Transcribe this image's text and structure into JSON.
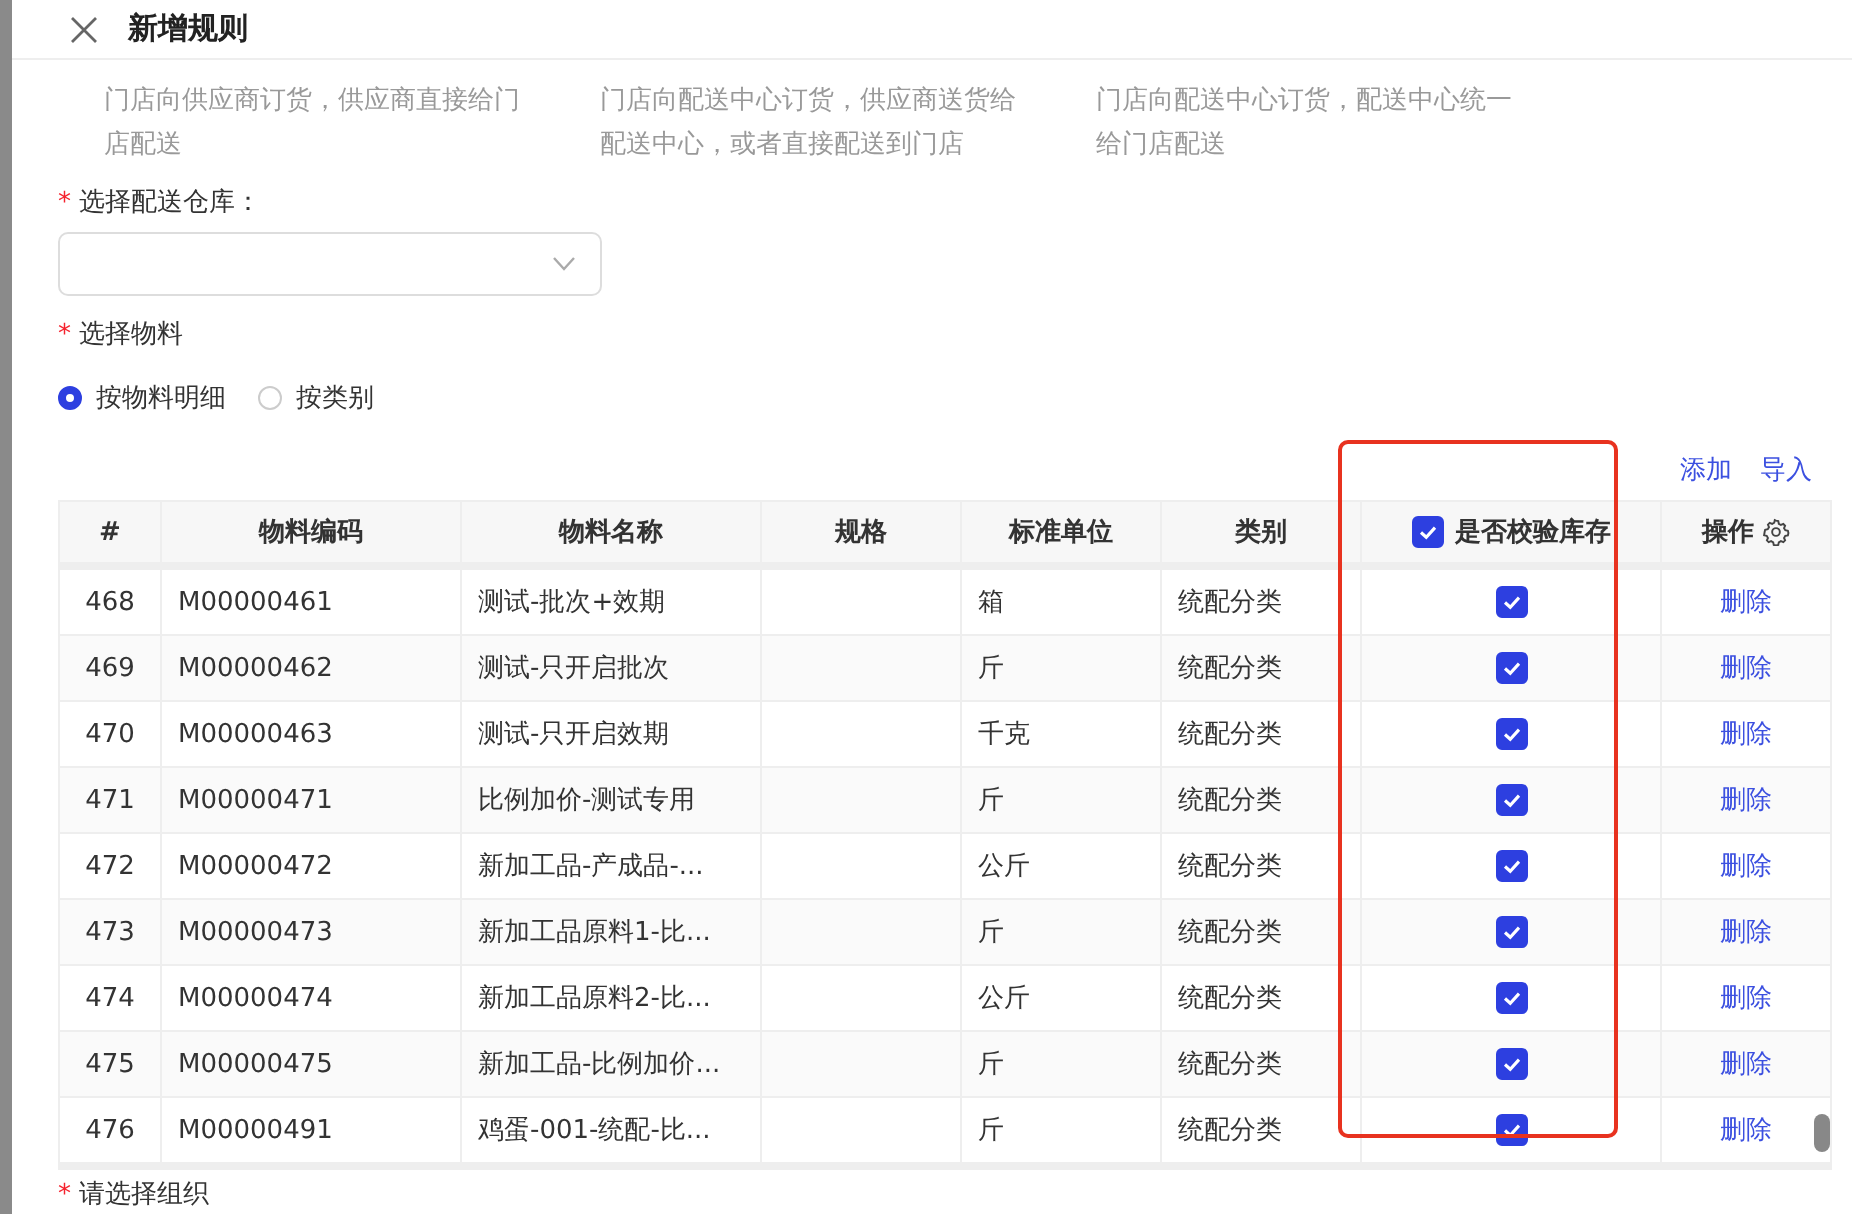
{
  "drawer": {
    "title": "新增规则"
  },
  "mode_descriptions": [
    "门店向供应商订货，供应商直接给门店配送",
    "门店向配送中心订货，供应商送货给配送中心，或者直接配送到门店",
    "门店向配送中心订货，配送中心统一给门店配送"
  ],
  "warehouse_field": {
    "required_mark": "*",
    "label": "选择配送仓库："
  },
  "material_section": {
    "required_mark": "*",
    "label": "选择物料",
    "radio_options": [
      {
        "label": "按物料明细",
        "selected": true
      },
      {
        "label": "按类别",
        "selected": false
      }
    ]
  },
  "table_actions": [
    "添加",
    "导入"
  ],
  "table": {
    "columns": [
      "#",
      "物料编码",
      "物料名称",
      "规格",
      "标准单位",
      "类别",
      "是否校验库存",
      "操作"
    ],
    "header_check_all": true,
    "rows": [
      {
        "index": "468",
        "code": "M00000461",
        "name": "测试-批次+效期",
        "spec": "",
        "unit": "箱",
        "category": "统配分类",
        "check_stock": true,
        "action": "删除"
      },
      {
        "index": "469",
        "code": "M00000462",
        "name": "测试-只开启批次",
        "spec": "",
        "unit": "斤",
        "category": "统配分类",
        "check_stock": true,
        "action": "删除"
      },
      {
        "index": "470",
        "code": "M00000463",
        "name": "测试-只开启效期",
        "spec": "",
        "unit": "千克",
        "category": "统配分类",
        "check_stock": true,
        "action": "删除"
      },
      {
        "index": "471",
        "code": "M00000471",
        "name": "比例加价-测试专用",
        "spec": "",
        "unit": "斤",
        "category": "统配分类",
        "check_stock": true,
        "action": "删除"
      },
      {
        "index": "472",
        "code": "M00000472",
        "name": "新加工品-产成品-...",
        "spec": "",
        "unit": "公斤",
        "category": "统配分类",
        "check_stock": true,
        "action": "删除"
      },
      {
        "index": "473",
        "code": "M00000473",
        "name": "新加工品原料1-比...",
        "spec": "",
        "unit": "斤",
        "category": "统配分类",
        "check_stock": true,
        "action": "删除"
      },
      {
        "index": "474",
        "code": "M00000474",
        "name": "新加工品原料2-比...",
        "spec": "",
        "unit": "公斤",
        "category": "统配分类",
        "check_stock": true,
        "action": "删除"
      },
      {
        "index": "475",
        "code": "M00000475",
        "name": "新加工品-比例加价...",
        "spec": "",
        "unit": "斤",
        "category": "统配分类",
        "check_stock": true,
        "action": "删除"
      },
      {
        "index": "476",
        "code": "M00000491",
        "name": "鸡蛋-001-统配-比...",
        "spec": "",
        "unit": "斤",
        "category": "统配分类",
        "check_stock": true,
        "action": "删除"
      }
    ]
  },
  "organization_field": {
    "required_mark": "*",
    "label": "请选择组织"
  }
}
